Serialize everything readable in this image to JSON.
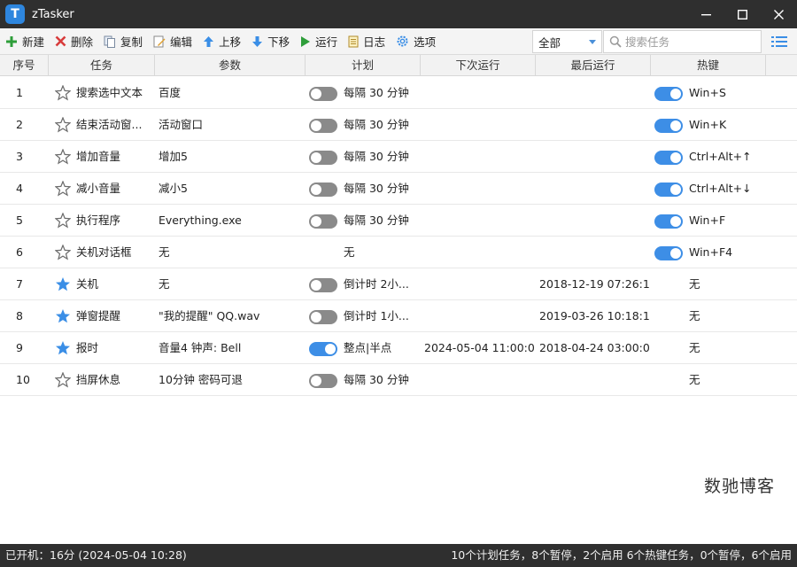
{
  "window": {
    "title": "zTasker",
    "logo_letter": "T"
  },
  "toolbar": {
    "new_label": "新建",
    "delete_label": "删除",
    "copy_label": "复制",
    "edit_label": "编辑",
    "move_up_label": "上移",
    "move_down_label": "下移",
    "run_label": "运行",
    "log_label": "日志",
    "options_label": "选项",
    "filter_value": "全部",
    "search_placeholder": "搜索任务"
  },
  "columns": {
    "index": "序号",
    "task": "任务",
    "params": "参数",
    "schedule": "计划",
    "next_run": "下次运行",
    "last_run": "最后运行",
    "hotkey": "热键"
  },
  "tasks": [
    {
      "index": "1",
      "starred": false,
      "name": "搜索选中文本",
      "params": "百度",
      "schedule_toggle": "off",
      "schedule": "每隔 30 分钟",
      "next_run": "",
      "last_run": "",
      "hotkey_toggle": "on",
      "hotkey": "Win+S"
    },
    {
      "index": "2",
      "starred": false,
      "name": "结束活动窗...",
      "params": "活动窗口",
      "schedule_toggle": "off",
      "schedule": "每隔 30 分钟",
      "next_run": "",
      "last_run": "",
      "hotkey_toggle": "on",
      "hotkey": "Win+K"
    },
    {
      "index": "3",
      "starred": false,
      "name": "增加音量",
      "params": "增加5",
      "schedule_toggle": "off",
      "schedule": "每隔 30 分钟",
      "next_run": "",
      "last_run": "",
      "hotkey_toggle": "on",
      "hotkey": "Ctrl+Alt+↑"
    },
    {
      "index": "4",
      "starred": false,
      "name": "减小音量",
      "params": "减小5",
      "schedule_toggle": "off",
      "schedule": "每隔 30 分钟",
      "next_run": "",
      "last_run": "",
      "hotkey_toggle": "on",
      "hotkey": "Ctrl+Alt+↓"
    },
    {
      "index": "5",
      "starred": false,
      "name": "执行程序",
      "params": "Everything.exe",
      "schedule_toggle": "off",
      "schedule": "每隔 30 分钟",
      "next_run": "",
      "last_run": "",
      "hotkey_toggle": "on",
      "hotkey": "Win+F"
    },
    {
      "index": "6",
      "starred": false,
      "name": "关机对话框",
      "params": "无",
      "schedule_toggle": "none",
      "schedule": "无",
      "next_run": "",
      "last_run": "",
      "hotkey_toggle": "on",
      "hotkey": "Win+F4"
    },
    {
      "index": "7",
      "starred": true,
      "name": "关机",
      "params": "无",
      "schedule_toggle": "off",
      "schedule": "倒计时 2小...",
      "next_run": "",
      "last_run": "2018-12-19 07:26:18",
      "hotkey_toggle": "none",
      "hotkey": "无"
    },
    {
      "index": "8",
      "starred": true,
      "name": "弹窗提醒",
      "params": "\"我的提醒\" QQ.wav",
      "schedule_toggle": "off",
      "schedule": "倒计时 1小...",
      "next_run": "",
      "last_run": "2019-03-26 10:18:11",
      "hotkey_toggle": "none",
      "hotkey": "无"
    },
    {
      "index": "9",
      "starred": true,
      "name": "报时",
      "params": "音量4 钟声: Bell",
      "schedule_toggle": "on",
      "schedule": "整点|半点",
      "next_run": "2024-05-04 11:00:00",
      "last_run": "2018-04-24 03:00:00",
      "hotkey_toggle": "none",
      "hotkey": "无"
    },
    {
      "index": "10",
      "starred": false,
      "name": "挡屏休息",
      "params": "10分钟 密码可退",
      "schedule_toggle": "off",
      "schedule": "每隔 30 分钟",
      "next_run": "",
      "last_run": "",
      "hotkey_toggle": "none",
      "hotkey": "无"
    }
  ],
  "watermark": "数驰博客",
  "status": {
    "uptime": "已开机：16分 (2024-05-04 10:28)",
    "summary": "10个计划任务，8个暂停，2个启用   6个热键任务，0个暂停，6个启用"
  },
  "colors": {
    "toggle_on": "#3d8ee6",
    "toggle_off": "#8a8a8a",
    "star_filled": "#3a8ee6",
    "titlebar": "#2f2f2f"
  }
}
